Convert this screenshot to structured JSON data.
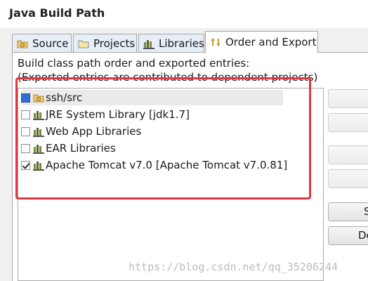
{
  "window": {
    "title": "Java Build Path"
  },
  "tabs": [
    {
      "label": "Source",
      "icon": "source-folder-icon",
      "active": false
    },
    {
      "label": "Projects",
      "icon": "projects-icon",
      "active": false
    },
    {
      "label": "Libraries",
      "icon": "libraries-icon",
      "active": false
    },
    {
      "label": "Order and Export",
      "icon": "order-export-icon",
      "active": true
    }
  ],
  "panel": {
    "description_line1": "Build class path order and exported entries:",
    "description_line2": "(Exported entries are contributed to dependent projects)"
  },
  "entries": [
    {
      "label": "ssh/src",
      "icon": "source-folder-icon",
      "checked": true,
      "selected": true
    },
    {
      "label": "JRE System Library [jdk1.7]",
      "icon": "library-icon",
      "checked": false,
      "selected": false
    },
    {
      "label": "Web App Libraries",
      "icon": "library-icon",
      "checked": false,
      "selected": false
    },
    {
      "label": "EAR Libraries",
      "icon": "library-icon",
      "checked": false,
      "selected": false
    },
    {
      "label": "Apache Tomcat v7.0 [Apache Tomcat v7.0.81]",
      "icon": "library-icon",
      "checked": true,
      "selected": false
    }
  ],
  "side_buttons": [
    {
      "label": "",
      "enabled": false
    },
    {
      "label": "",
      "enabled": false
    },
    {
      "label": "",
      "enabled": false
    },
    {
      "label": "",
      "enabled": false
    },
    {
      "label": "S",
      "enabled": true
    },
    {
      "label": "De",
      "enabled": true
    }
  ],
  "annotation": {
    "highlight_color": "#e0393b"
  },
  "watermark": "https://blog.csdn.net/qq_35206244",
  "colors": {
    "tab_bg": "#e6eef8",
    "selection_bg": "#eaeaea",
    "checkbox_fill": "#2f6fd1"
  }
}
